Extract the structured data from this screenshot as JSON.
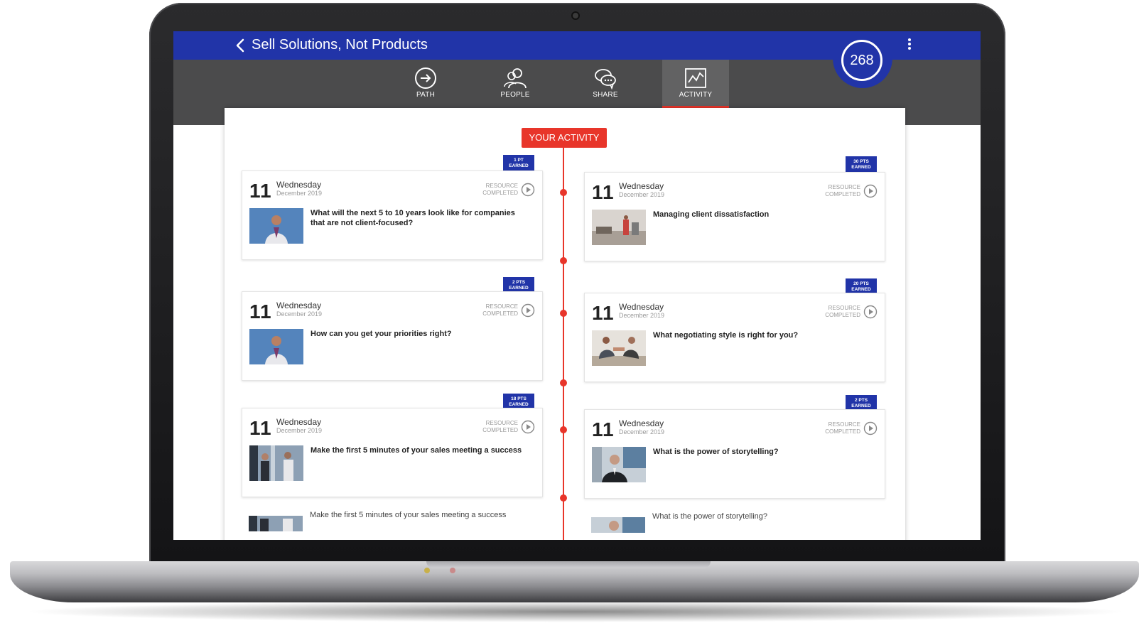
{
  "header": {
    "title": "Sell Solutions, Not Products",
    "points": "268"
  },
  "tabs": [
    {
      "label": "PATH",
      "icon": "arrow-right-circle-icon"
    },
    {
      "label": "PEOPLE",
      "icon": "people-icon"
    },
    {
      "label": "SHARE",
      "icon": "chat-bubbles-icon"
    },
    {
      "label": "ACTIVITY",
      "icon": "activity-chart-icon",
      "active": true
    }
  ],
  "section_label": "YOUR ACTIVITY",
  "activities": [
    {
      "day": "11",
      "weekday": "Wednesday",
      "month_year": "December 2019",
      "status_line1": "RESOURCE",
      "status_line2": "COMPLETED",
      "pts_line1": "1 PT",
      "pts_line2": "EARNED",
      "title": "What will the next 5 to 10 years look like for companies that are not client-focused?"
    },
    {
      "day": "11",
      "weekday": "Wednesday",
      "month_year": "December 2019",
      "status_line1": "RESOURCE",
      "status_line2": "COMPLETED",
      "pts_line1": "30 PTS",
      "pts_line2": "EARNED",
      "title": "Managing client dissatisfaction"
    },
    {
      "day": "11",
      "weekday": "Wednesday",
      "month_year": "December 2019",
      "status_line1": "RESOURCE",
      "status_line2": "COMPLETED",
      "pts_line1": "2 PTS",
      "pts_line2": "EARNED",
      "title": "How can you get your priorities right?"
    },
    {
      "day": "11",
      "weekday": "Wednesday",
      "month_year": "December 2019",
      "status_line1": "RESOURCE",
      "status_line2": "COMPLETED",
      "pts_line1": "20 PTS",
      "pts_line2": "EARNED",
      "title": "What negotiating style is right for you?"
    },
    {
      "day": "11",
      "weekday": "Wednesday",
      "month_year": "December 2019",
      "status_line1": "RESOURCE",
      "status_line2": "COMPLETED",
      "pts_line1": "18 PTS",
      "pts_line2": "EARNED",
      "title": "Make the first 5 minutes of your sales meeting a success"
    },
    {
      "day": "11",
      "weekday": "Wednesday",
      "month_year": "December 2019",
      "status_line1": "RESOURCE",
      "status_line2": "COMPLETED",
      "pts_line1": "2 PTS",
      "pts_line2": "EARNED",
      "title": "What is the power of storytelling?"
    }
  ],
  "partial": [
    {
      "title": "Make the first 5 minutes of your sales meeting a success"
    },
    {
      "title": "What is the power of storytelling?"
    }
  ],
  "colors": {
    "brand_blue": "#2134a8",
    "accent_red": "#e8352a",
    "nav_gray": "#4b4b4c"
  }
}
